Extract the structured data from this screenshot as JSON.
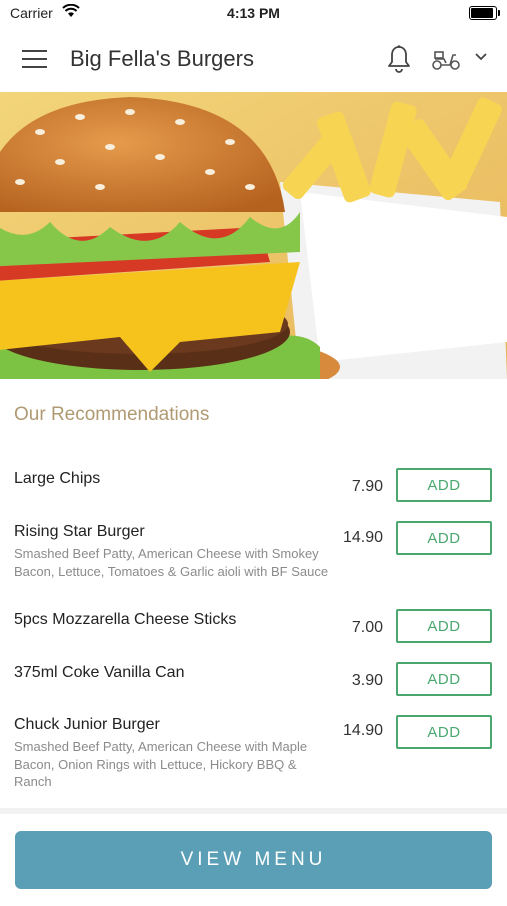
{
  "status_bar": {
    "carrier": "Carrier",
    "time": "4:13 PM"
  },
  "header": {
    "title": "Big Fella's Burgers"
  },
  "section": {
    "title": "Our Recommendations"
  },
  "items": [
    {
      "name": "Large Chips",
      "desc": "",
      "price": "7.90",
      "add": "ADD"
    },
    {
      "name": "Rising Star Burger",
      "desc": "Smashed Beef Patty, American Cheese with Smokey Bacon, Lettuce, Tomatoes & Garlic aioli with BF Sauce",
      "price": "14.90",
      "add": "ADD"
    },
    {
      "name": "5pcs Mozzarella Cheese Sticks",
      "desc": "",
      "price": "7.00",
      "add": "ADD"
    },
    {
      "name": "375ml Coke Vanilla Can",
      "desc": "",
      "price": "3.90",
      "add": "ADD"
    },
    {
      "name": "Chuck Junior Burger",
      "desc": "Smashed Beef Patty, American Cheese with Maple Bacon, Onion Rings with Lettuce, Hickory BBQ & Ranch",
      "price": "14.90",
      "add": "ADD"
    }
  ],
  "footer": {
    "view_menu": "VIEW MENU"
  },
  "colors": {
    "accent": "#5b9fb7",
    "add_green": "#4aa86f",
    "section_title": "#b09a73"
  },
  "icons": [
    "menu-icon",
    "bell-icon",
    "scooter-icon",
    "chevron-down-icon",
    "wifi-icon",
    "battery-icon"
  ]
}
